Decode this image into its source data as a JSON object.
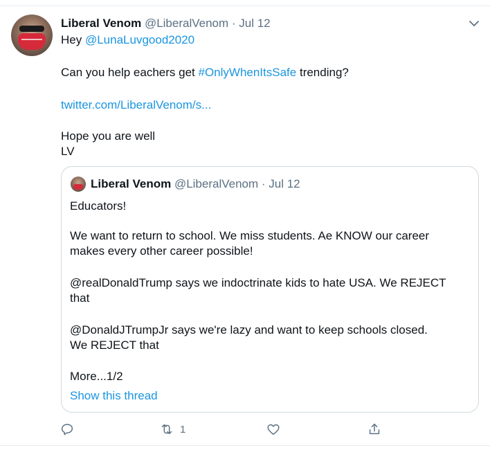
{
  "tweet": {
    "display_name": "Liberal Venom",
    "handle": "@LiberalVenom",
    "date_sep": "· Jul 12",
    "reply_prefix": "Hey",
    "mention": "@LunaLuvgood2020",
    "body_pre": "Can you help eachers get",
    "hashtag": "#OnlyWhenItsSafe",
    "body_post": "trending?",
    "short_link": "twitter.com/LiberalVenom/s...",
    "closing_1": "Hope you are well",
    "closing_2": "LV"
  },
  "quote": {
    "display_name": "Liberal Venom",
    "handle": "@LiberalVenom",
    "date_sep": "· Jul 12",
    "lines": [
      "Educators!",
      "We want to return to school. We miss students. Ae KNOW our career",
      "makes every other career possible!",
      "@realDonaldTrump says we indoctrinate kids to hate USA. We REJECT",
      "that",
      "@DonaldJTrumpJr says we're lazy and want to keep schools closed.",
      "We REJECT that",
      "More...1/2"
    ],
    "show_thread": "Show this thread"
  },
  "actions": {
    "reply_count": "",
    "retweet_count": "1",
    "like_count": "",
    "icons": [
      "reply-icon",
      "retweet-icon",
      "like-icon",
      "share-icon"
    ]
  },
  "colors": {
    "link": "#1b95e0",
    "muted": "#5b7083",
    "text": "#0f1419",
    "border": "#cfd9de"
  }
}
